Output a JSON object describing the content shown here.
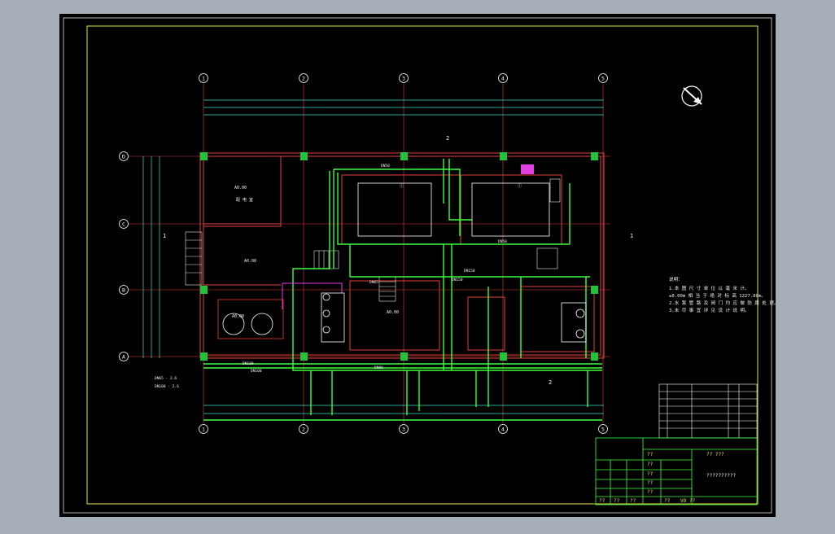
{
  "colors": {
    "viewport_bg": "#a5adb9",
    "canvas_bg": "#000000",
    "frame": "#ffffff",
    "border_yellow": "#e6e64a",
    "wall_red": "#e0403a",
    "pipe_green": "#3cff3c",
    "column_green": "#22c33a",
    "dim_line": "#37e0c8",
    "text_white": "#f2f2f2",
    "magenta": "#e040e0"
  },
  "grid_axes": {
    "columns": [
      "1",
      "2",
      "3",
      "4",
      "5"
    ],
    "rows": [
      "D",
      "C",
      "B",
      "A"
    ]
  },
  "rooms": [
    {
      "id": "r1",
      "label": "A0.00",
      "sub": "配 电 室"
    },
    {
      "id": "r2",
      "label": "A0.00"
    },
    {
      "id": "r3",
      "label": "A0.00"
    },
    {
      "id": "r4",
      "label": "ⓘ"
    },
    {
      "id": "r5",
      "label": "ⓘ"
    },
    {
      "id": "r6",
      "label": "A0.00"
    }
  ],
  "pipe_labels": [
    "DN50",
    "DN65",
    "DN100",
    "DN150",
    "DN80",
    "DN150",
    "DN50",
    "DN100"
  ],
  "annotations": {
    "notes_title": "说明：",
    "notes": [
      "1.本 图 尺 寸 单 位 以 毫 米 计。",
      "  ±0.00m 相 当 于 绝 对 标 高 1227.80m。",
      "2.水 泵 管 路 及 阀 门 均 应 做 防 腐 处 理。",
      "3.未 尽 事 宜 详 见 设 计 说 明。"
    ],
    "axis_marker_1": "1",
    "axis_marker_2": "2",
    "bottom_left_1": "DN65 - 2.6",
    "bottom_left_2": "DN100 - 2.6",
    "title_center": "??????????",
    "title_mark": "?? ???",
    "title_mark2": "VO  ??"
  },
  "title_block_rows": [
    "??",
    "??",
    "??",
    "??",
    "??"
  ],
  "title_block_footer": [
    "??",
    "??",
    "??",
    "??"
  ]
}
